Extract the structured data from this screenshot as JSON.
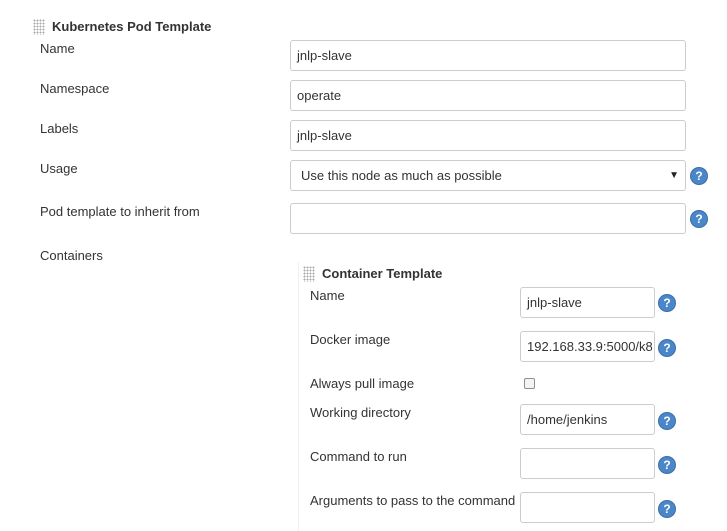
{
  "pod_template": {
    "title": "Kubernetes Pod Template",
    "name": {
      "label": "Name",
      "value": "jnlp-slave"
    },
    "namespace": {
      "label": "Namespace",
      "value": "operate"
    },
    "labels": {
      "label": "Labels",
      "value": "jnlp-slave"
    },
    "usage": {
      "label": "Usage",
      "selected": "Use this node as much as possible"
    },
    "inherit_from": {
      "label": "Pod template to inherit from",
      "value": ""
    },
    "containers_label": "Containers"
  },
  "container_template": {
    "title": "Container Template",
    "name": {
      "label": "Name",
      "value": "jnlp-slave"
    },
    "docker_image": {
      "label": "Docker image",
      "value": "192.168.33.9:5000/k8"
    },
    "always_pull": {
      "label": "Always pull image",
      "checked": false
    },
    "working_directory": {
      "label": "Working directory",
      "value": "/home/jenkins"
    },
    "command": {
      "label": "Command to run",
      "value": ""
    },
    "arguments": {
      "label": "Arguments to pass to the command",
      "value": ""
    }
  },
  "icons": {
    "help": "?",
    "dropdown": "▼"
  },
  "colors": {
    "help_icon": "#4a86c8",
    "border": "#cccccc"
  }
}
